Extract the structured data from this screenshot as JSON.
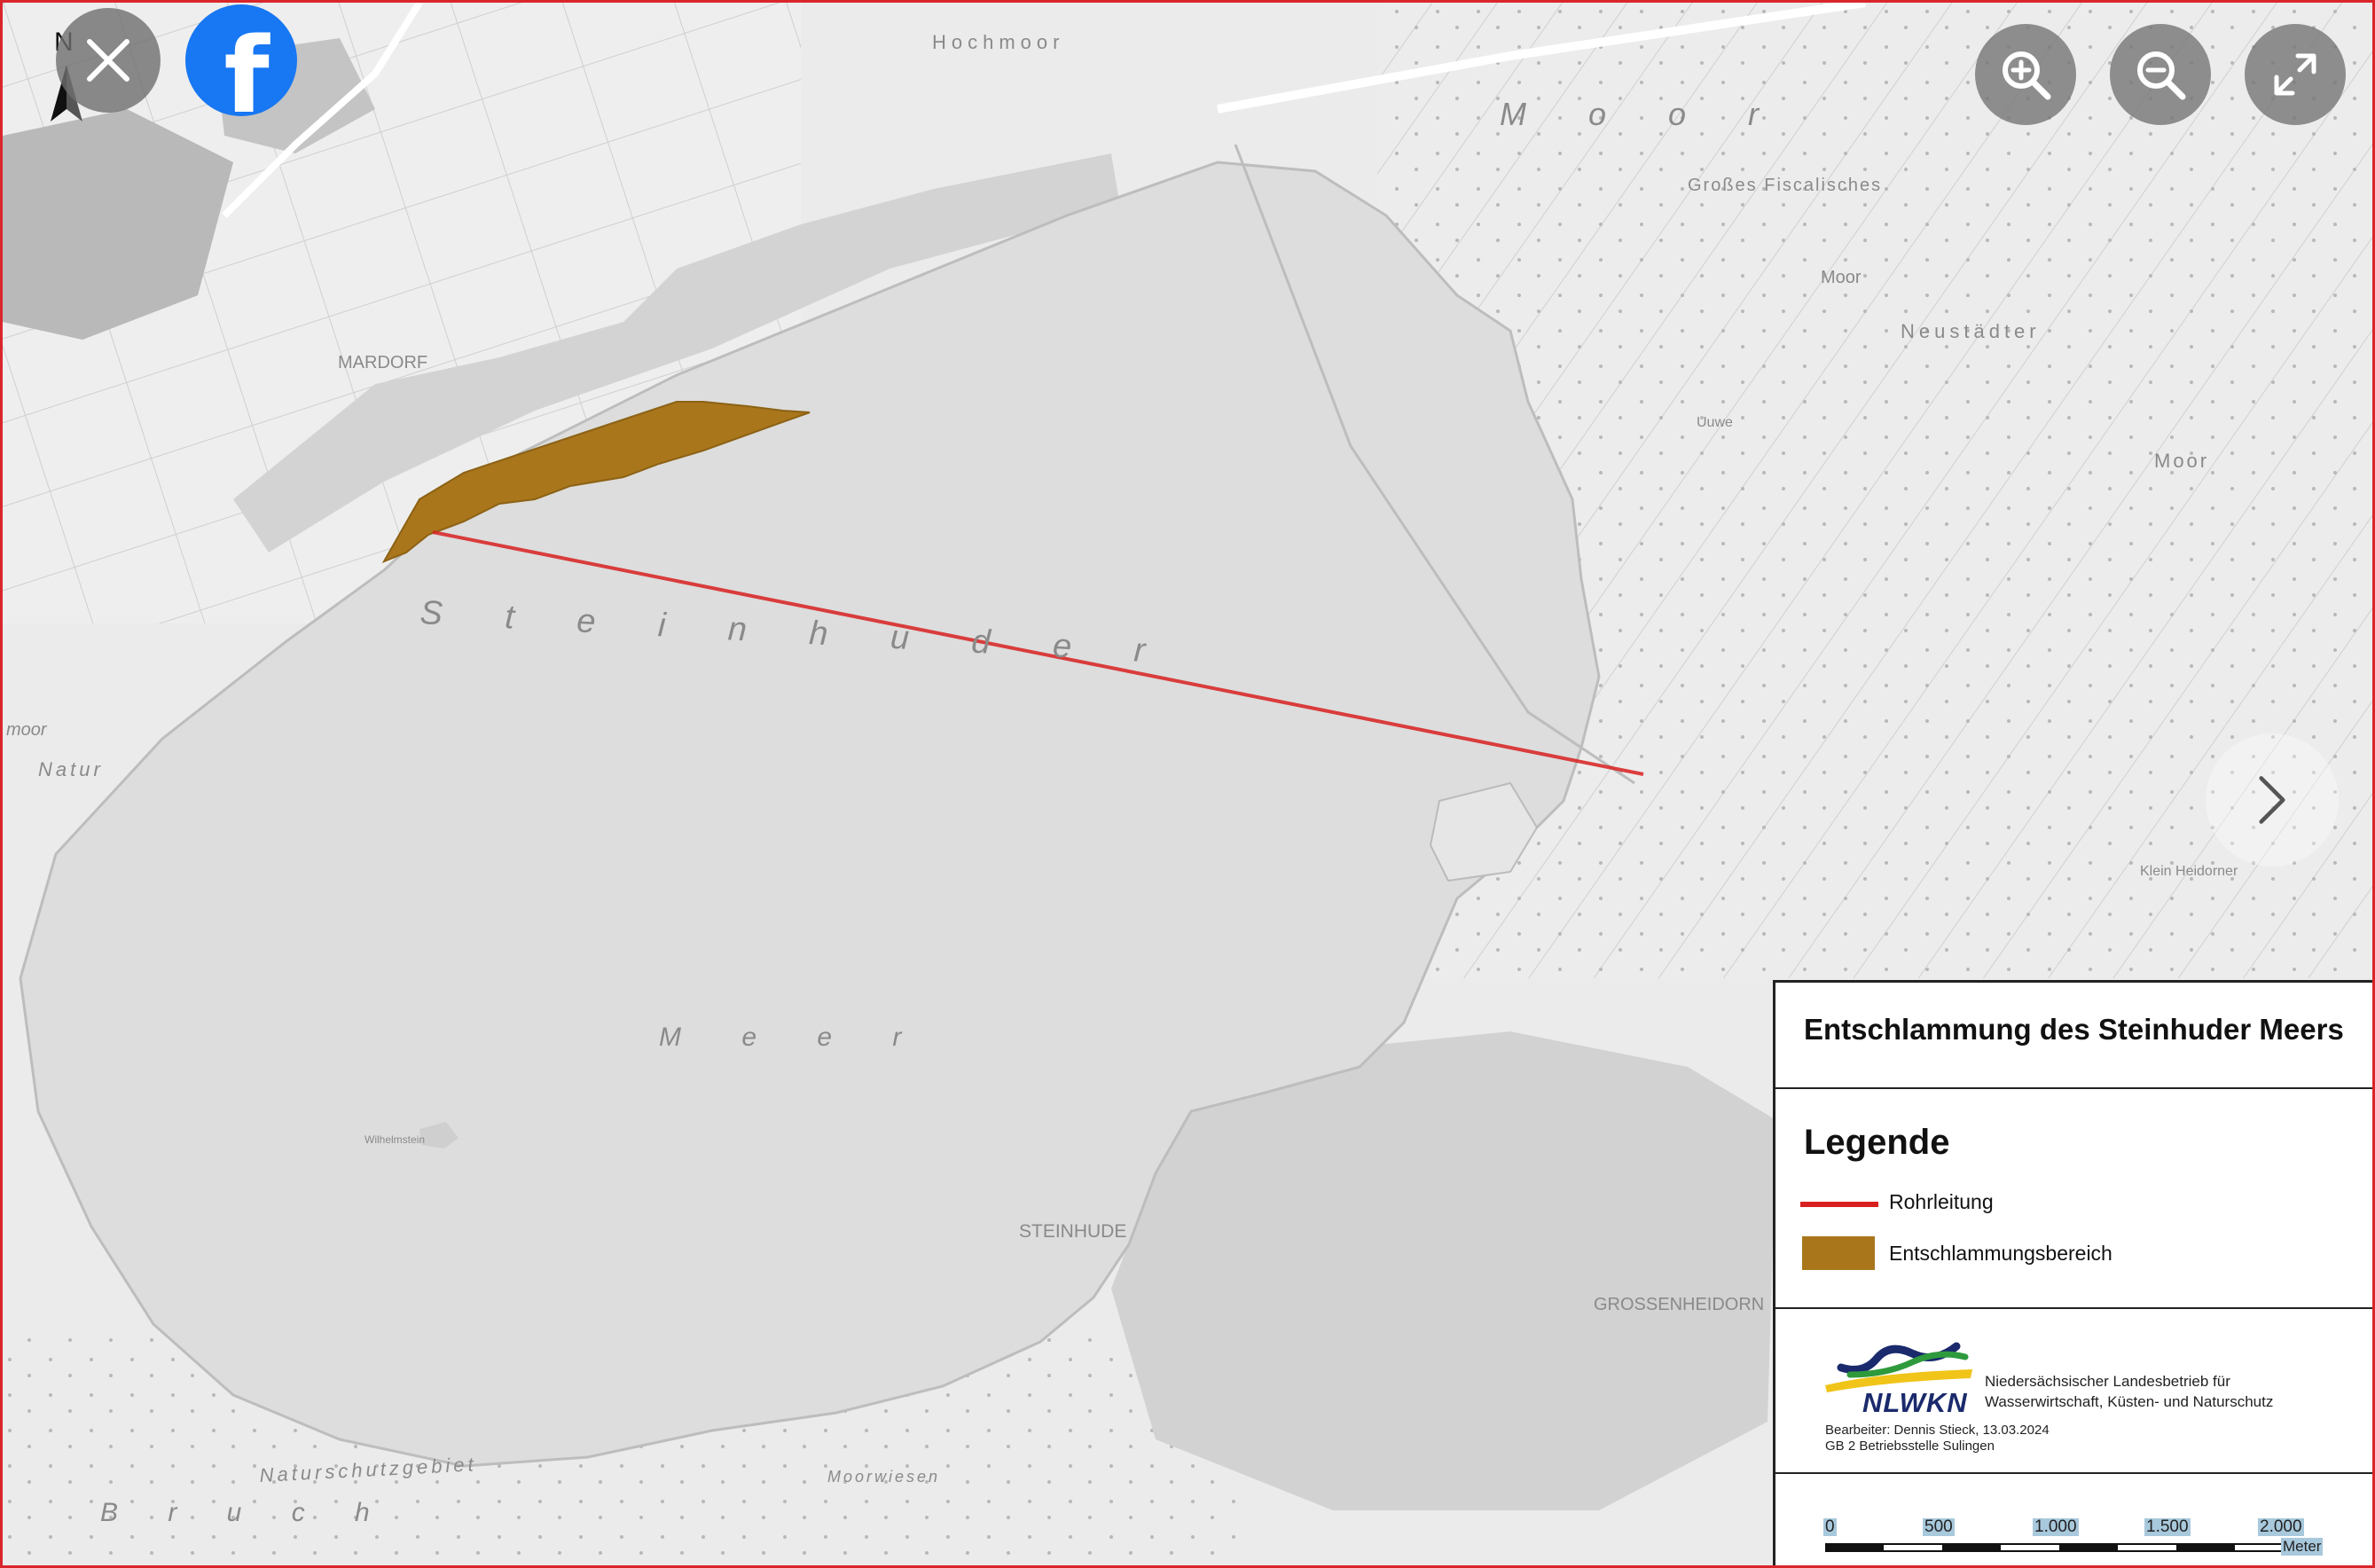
{
  "map": {
    "labels": {
      "hochmoor": "Hochmoor",
      "moor_top": "M o o r",
      "grosses_fiscalisches": "Großes Fiscalisches",
      "moor_right1": "Moor",
      "neustaedter": "Neustädter",
      "moor_right2": "Moor",
      "mardorf": "MARDORF",
      "steinhuder": "S t e i n h u d e r",
      "meer": "M e e r",
      "steinhude": "STEINHUDE",
      "grossenheidorn": "GROSSENHEIDORN",
      "natur": "Natur",
      "naturschutzgebiet": "Naturschutzgebiet",
      "moorwiesen": "Moorwiesen",
      "bruch": "B r u c h",
      "moor_left": "moor",
      "uuwe": "Uuwe",
      "klein_heidorner": "Klein Heidorner",
      "wilhelmstein": "Wilhelmstein"
    },
    "colors": {
      "lake": "#dedede",
      "land": "#ececec",
      "pipeline": "#d92020",
      "dredging_area": "#a9761c"
    }
  },
  "controls": {
    "close_icon": "close-icon",
    "north_letter": "N",
    "facebook_letter": "f",
    "zoom_in_icon": "zoom-in-icon",
    "zoom_out_icon": "zoom-out-icon",
    "fullscreen_icon": "fullscreen-icon",
    "next_icon": "chevron-right-icon"
  },
  "legend": {
    "title": "Entschlammung des Steinhuder Meers",
    "heading": "Legende",
    "items": [
      {
        "label": "Rohrleitung",
        "color": "#d92020"
      },
      {
        "label": "Entschlammungsbereich",
        "color": "#a9761c"
      }
    ],
    "org_short": "NLWKN",
    "org_line1": "Niedersächsischer Landesbetrieb für",
    "org_line2": "Wasserwirtschaft, Küsten- und Naturschutz",
    "author": "Bearbeiter: Dennis Stieck, 13.03.2024",
    "department": "GB 2 Betriebsstelle Sulingen",
    "scale": {
      "ticks": [
        "0",
        "500",
        "1.000",
        "1.500",
        "2.000"
      ],
      "unit": "Meter"
    }
  }
}
